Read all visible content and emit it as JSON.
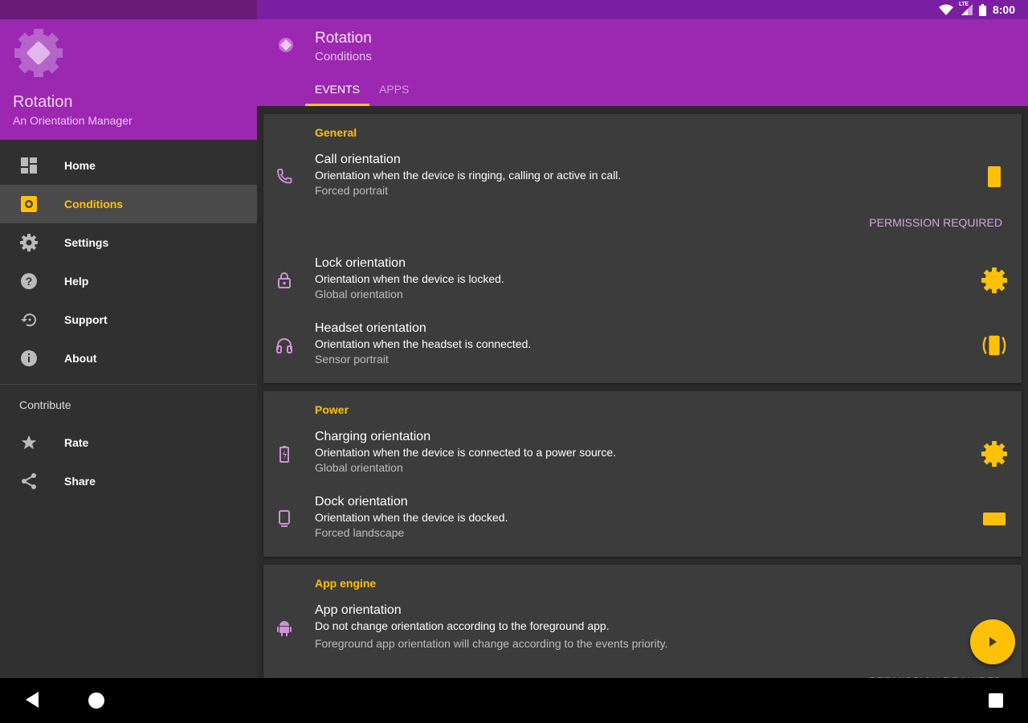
{
  "status": {
    "time": "8:00",
    "network": "LTE"
  },
  "drawer": {
    "app_name": "Rotation",
    "app_subtitle": "An Orientation Manager",
    "items": [
      {
        "label": "Home"
      },
      {
        "label": "Conditions"
      },
      {
        "label": "Settings"
      },
      {
        "label": "Help"
      },
      {
        "label": "Support"
      },
      {
        "label": "About"
      }
    ],
    "section": "Contribute",
    "contribute": [
      {
        "label": "Rate"
      },
      {
        "label": "Share"
      }
    ]
  },
  "appbar": {
    "title": "Rotation",
    "subtitle": "Conditions",
    "tabs": [
      {
        "label": "EVENTS"
      },
      {
        "label": "APPS"
      }
    ]
  },
  "cards": [
    {
      "title": "General",
      "rows": [
        {
          "title": "Call orientation",
          "desc": "Orientation when the device is ringing, calling or active in call.",
          "sub": "Forced portrait",
          "action": "PERMISSION REQUIRED"
        },
        {
          "title": "Lock orientation",
          "desc": "Orientation when the device is locked.",
          "sub": "Global orientation"
        },
        {
          "title": "Headset orientation",
          "desc": "Orientation when the headset is connected.",
          "sub": "Sensor portrait"
        }
      ]
    },
    {
      "title": "Power",
      "rows": [
        {
          "title": "Charging orientation",
          "desc": "Orientation when the device is connected to a power source.",
          "sub": "Global orientation"
        },
        {
          "title": "Dock orientation",
          "desc": "Orientation when the device is docked.",
          "sub": "Forced landscape"
        }
      ]
    },
    {
      "title": "App engine",
      "rows": [
        {
          "title": "App orientation",
          "desc": "Do not change orientation according to the foreground app.",
          "sub": "Foreground app orientation will change according to the events priority.",
          "action": "PERMISSION REQUIRED"
        }
      ]
    }
  ],
  "colors": {
    "primary": "#9c27b0",
    "accent": "#ffc107",
    "icon": "#ce93d8"
  }
}
